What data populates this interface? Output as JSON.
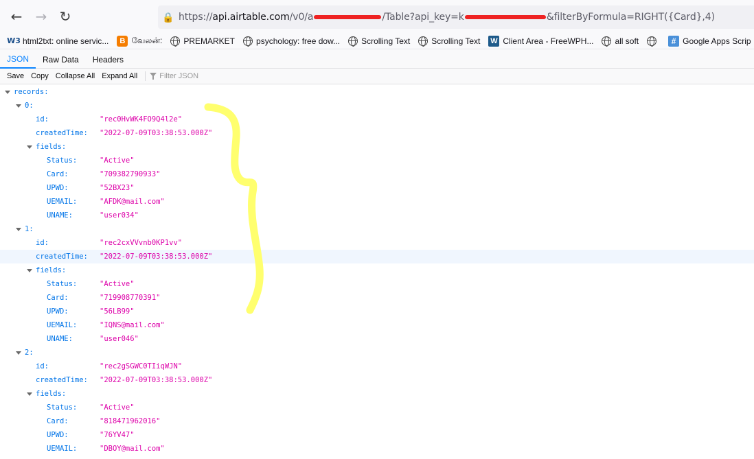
{
  "nav": {
    "url_prefix": "https://",
    "url_host": "api.airtable.com",
    "url_path_1": "/v0/a",
    "url_path_2": "/Table?api_key=k",
    "url_path_3": "&filterByFormula=RIGHT({Card},4)"
  },
  "bookmarks": [
    {
      "label": "html2txt: online servic...",
      "icon": "w3-icon"
    },
    {
      "label": "வேலன்:",
      "icon": "blogger-icon"
    },
    {
      "label": "PREMARKET",
      "icon": "globe-icon"
    },
    {
      "label": "psychology: free dow...",
      "icon": "globe-icon"
    },
    {
      "label": "Scrolling Text",
      "icon": "globe-icon"
    },
    {
      "label": "Scrolling Text",
      "icon": "globe-icon"
    },
    {
      "label": "Client Area - FreeWPH...",
      "icon": "wordpress-icon"
    },
    {
      "label": "all soft",
      "icon": "globe-icon"
    },
    {
      "label": "",
      "icon": "globe-icon"
    },
    {
      "label": "Google Apps Scrip",
      "icon": "apps-script-icon"
    }
  ],
  "tabs": {
    "json": "JSON",
    "raw": "Raw Data",
    "headers": "Headers"
  },
  "toolbar": {
    "save": "Save",
    "copy": "Copy",
    "collapse": "Collapse All",
    "expand": "Expand All",
    "filter_placeholder": "Filter JSON"
  },
  "tree": [
    {
      "key": "records:",
      "value": "",
      "depth": 0,
      "toggle": true
    },
    {
      "key": "0:",
      "value": "",
      "depth": 1,
      "toggle": true
    },
    {
      "key": "id:",
      "value": "\"rec0HvWK4FO9Q4l2e\"",
      "depth": 2
    },
    {
      "key": "createdTime:",
      "value": "\"2022-07-09T03:38:53.000Z\"",
      "depth": 2
    },
    {
      "key": "fields:",
      "value": "",
      "depth": 2,
      "toggle": true
    },
    {
      "key": "Status:",
      "value": "\"Active\"",
      "depth": 3
    },
    {
      "key": "Card:",
      "value": "\"709382790933\"",
      "depth": 3
    },
    {
      "key": "UPWD:",
      "value": "\"52BX23\"",
      "depth": 3
    },
    {
      "key": "UEMAIL:",
      "value": "\"AFDK@mail.com\"",
      "depth": 3
    },
    {
      "key": "UNAME:",
      "value": "\"user034\"",
      "depth": 3
    },
    {
      "key": "1:",
      "value": "",
      "depth": 1,
      "toggle": true
    },
    {
      "key": "id:",
      "value": "\"rec2cxVVvnb0KP1vv\"",
      "depth": 2
    },
    {
      "key": "createdTime:",
      "value": "\"2022-07-09T03:38:53.000Z\"",
      "depth": 2,
      "highlight": true
    },
    {
      "key": "fields:",
      "value": "",
      "depth": 2,
      "toggle": true
    },
    {
      "key": "Status:",
      "value": "\"Active\"",
      "depth": 3
    },
    {
      "key": "Card:",
      "value": "\"719908770391\"",
      "depth": 3
    },
    {
      "key": "UPWD:",
      "value": "\"56LB99\"",
      "depth": 3
    },
    {
      "key": "UEMAIL:",
      "value": "\"IQNS@mail.com\"",
      "depth": 3
    },
    {
      "key": "UNAME:",
      "value": "\"user046\"",
      "depth": 3
    },
    {
      "key": "2:",
      "value": "",
      "depth": 1,
      "toggle": true
    },
    {
      "key": "id:",
      "value": "\"rec2gSGWC0TIiqWJN\"",
      "depth": 2
    },
    {
      "key": "createdTime:",
      "value": "\"2022-07-09T03:38:53.000Z\"",
      "depth": 2
    },
    {
      "key": "fields:",
      "value": "",
      "depth": 2,
      "toggle": true
    },
    {
      "key": "Status:",
      "value": "\"Active\"",
      "depth": 3
    },
    {
      "key": "Card:",
      "value": "\"818471962016\"",
      "depth": 3
    },
    {
      "key": "UPWD:",
      "value": "\"76YV47\"",
      "depth": 3
    },
    {
      "key": "UEMAIL:",
      "value": "\"DBOY@mail.com\"",
      "depth": 3
    }
  ],
  "colors": {
    "key": "#0074e8",
    "value": "#dd00a9",
    "highlighter": "#ffff66",
    "redaction": "#ee2222"
  }
}
